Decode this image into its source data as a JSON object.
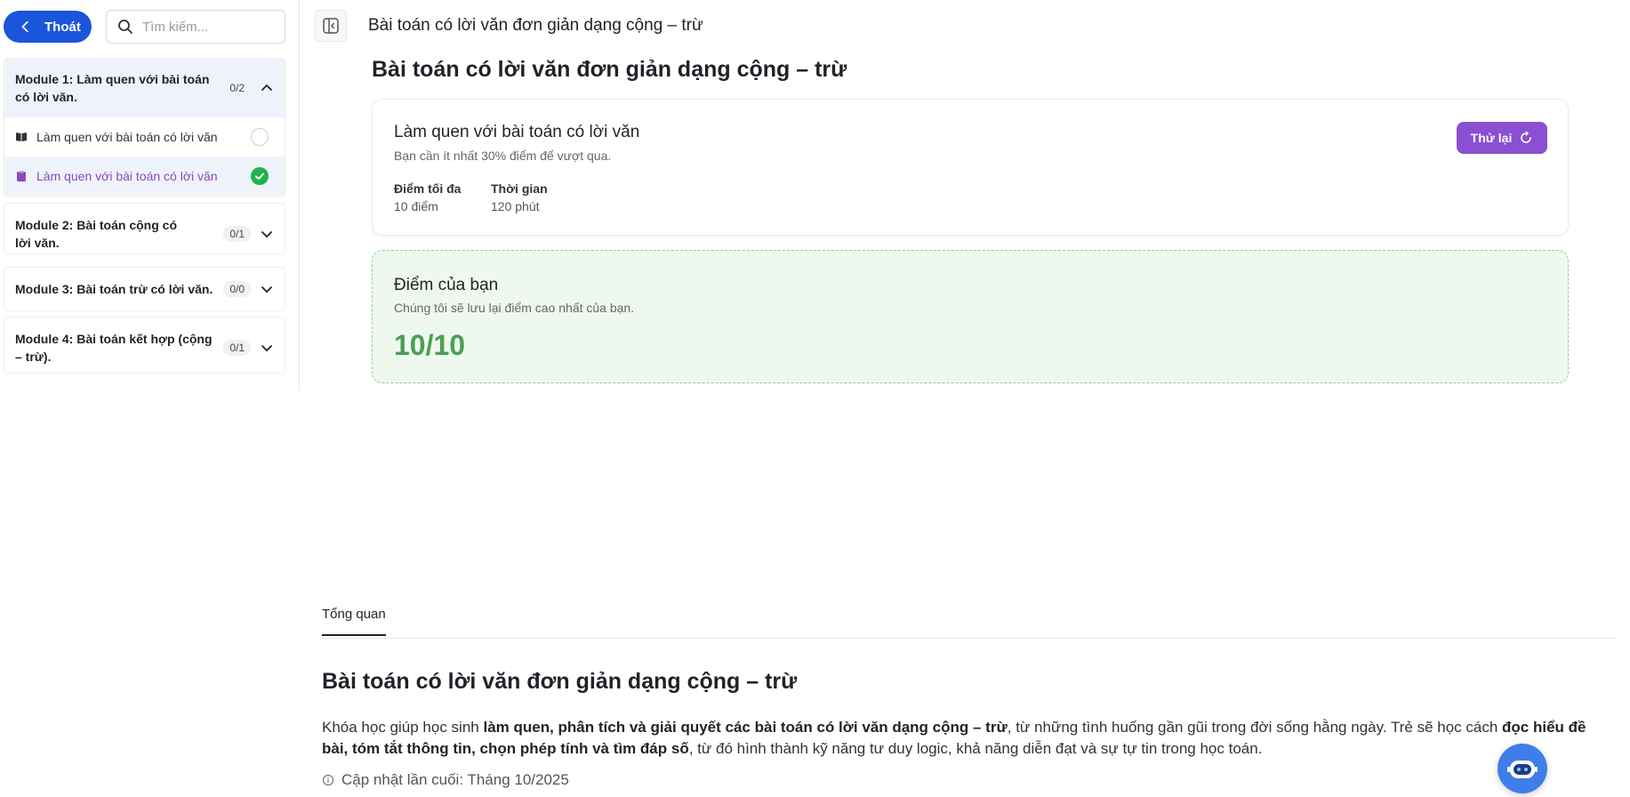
{
  "sidebar": {
    "exit_label": "Thoát",
    "search_placeholder": "Tìm kiếm...",
    "modules": [
      {
        "title": "Module 1: Làm quen với bài toán có lời văn.",
        "count": "0/2",
        "expanded": true,
        "lessons": [
          {
            "label": "Làm quen với bài toán có lời văn",
            "icon": "book-icon",
            "status": "not-started"
          },
          {
            "label": "Làm quen với bài toán có lời văn",
            "icon": "clipboard-icon",
            "status": "completed",
            "active": true
          }
        ]
      },
      {
        "title": "Module 2: Bài toán cộng có lời văn.",
        "count": "0/1",
        "expanded": false
      },
      {
        "title": "Module 3: Bài toán trừ có lời văn.",
        "count": "0/0",
        "expanded": false
      },
      {
        "title": "Module 4: Bài toán kết hợp (cộng – trừ).",
        "count": "0/1",
        "expanded": false
      }
    ]
  },
  "header": {
    "title": "Bài toán có lời văn đơn giản dạng cộng – trừ"
  },
  "main": {
    "page_title": "Bài toán có lời văn đơn giản dạng cộng – trừ",
    "quiz": {
      "title": "Làm quen với bài toán có lời văn",
      "pass_note": "Bạn cần ít nhất 30% điểm để vượt qua.",
      "max_score_label": "Điểm tối đa",
      "max_score_value": "10 điểm",
      "time_label": "Thời gian",
      "time_value": "120 phút",
      "retry_label": "Thử lại"
    },
    "score": {
      "title": "Điểm của bạn",
      "note": "Chúng tôi sẽ lưu lại điểm cao nhất của bạn.",
      "value": "10/10"
    }
  },
  "overview": {
    "tab_label": "Tổng quan",
    "title": "Bài toán có lời văn đơn giản dạng cộng – trừ",
    "desc_1": "Khóa học giúp học sinh ",
    "desc_b1": "làm quen, phân tích và giải quyết các bài toán có lời văn dạng cộng – trừ",
    "desc_2": ", từ những tình huống gần gũi trong đời sống hằng ngày. Trẻ sẽ học cách ",
    "desc_b2": "đọc hiểu đề bài, tóm tắt thông tin, chọn phép tính và tìm đáp số",
    "desc_3": ", từ đó hình thành kỹ năng tư duy logic, khả năng diễn đạt và sự tự tin trong học toán.",
    "updated": "Cập nhật lần cuối: Tháng 10/2025"
  },
  "colors": {
    "primary": "#1a56db",
    "accent_purple": "#8b4fd3",
    "success_green": "#22b24c",
    "score_green": "#4aa050"
  }
}
